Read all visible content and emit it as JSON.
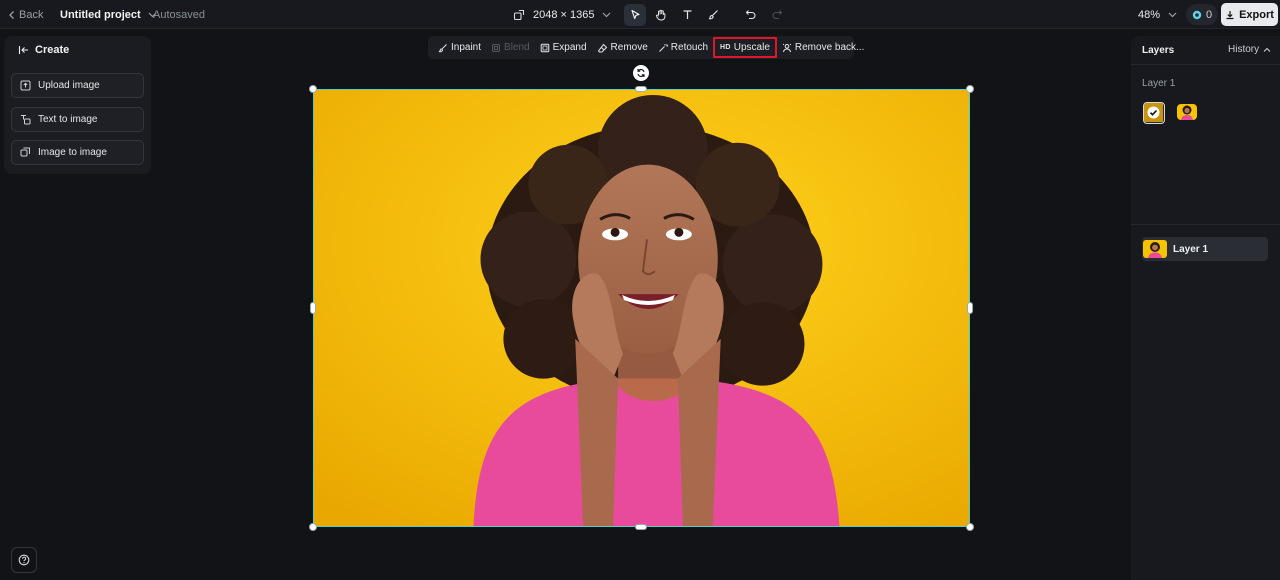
{
  "topbar": {
    "back_label": "Back",
    "project_name": "Untitled project",
    "autosave_status": "Autosaved",
    "canvas_size": "2048 × 1365",
    "zoom_level": "48%",
    "credits": "0",
    "export_label": "Export"
  },
  "create_panel": {
    "title": "Create",
    "buttons": [
      {
        "label": "Upload image"
      },
      {
        "label": "Text to image"
      },
      {
        "label": "Image to image"
      }
    ]
  },
  "edit_toolbar": {
    "items": [
      {
        "label": "Inpaint"
      },
      {
        "label": "Blend"
      },
      {
        "label": "Expand"
      },
      {
        "label": "Remove"
      },
      {
        "label": "Retouch"
      },
      {
        "label": "Upscale",
        "badge": "HD"
      },
      {
        "label": "Remove back..."
      }
    ]
  },
  "layers_panel": {
    "title": "Layers",
    "history_label": "History",
    "group_label": "Layer 1",
    "layers": [
      {
        "name": "Layer 1"
      }
    ]
  },
  "colors": {
    "accent_selection": "#4fd1c5",
    "highlight_box": "#e0162b",
    "background": "#111317"
  }
}
